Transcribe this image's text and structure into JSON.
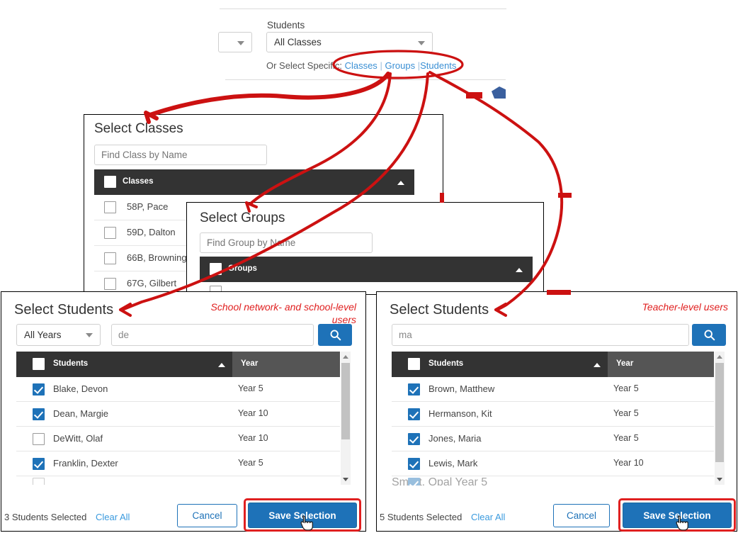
{
  "top": {
    "students_label": "Students",
    "class_select_value": "All Classes",
    "or_select_prefix": "Or Select Specific:",
    "links": [
      "Classes",
      "Groups",
      "Students"
    ],
    "separator": "|"
  },
  "select_classes": {
    "title": "Select Classes",
    "search_placeholder": "Find Class by Name",
    "header_label": "Classes",
    "rows": [
      {
        "name": "58P, Pace",
        "checked": false
      },
      {
        "name": "59D, Dalton",
        "checked": false
      },
      {
        "name": "66B, Browning",
        "checked": false
      },
      {
        "name": "67G, Gilbert",
        "checked": false
      }
    ]
  },
  "select_groups": {
    "title": "Select Groups",
    "search_placeholder": "Find Group by Name",
    "header_label": "Groups",
    "rows": [
      {
        "name": "",
        "checked": false
      }
    ]
  },
  "select_students_left": {
    "title": "Select Students",
    "note": "School network- and school-level users",
    "year_filter_value": "All Years",
    "search_value": "de",
    "search_icon": "search-icon",
    "columns": [
      "Students",
      "Year"
    ],
    "rows": [
      {
        "name": "Blake, Devon",
        "year": "Year 5",
        "checked": true
      },
      {
        "name": "Dean, Margie",
        "year": "Year 10",
        "checked": true
      },
      {
        "name": "DeWitt, Olaf",
        "year": "Year 10",
        "checked": false
      },
      {
        "name": "Franklin, Dexter",
        "year": "Year 5",
        "checked": true
      }
    ],
    "footer": {
      "status": "3 Students Selected",
      "clear_all": "Clear All",
      "cancel": "Cancel",
      "save": "Save Selection"
    }
  },
  "select_students_right": {
    "title": "Select Students",
    "note": "Teacher-level users",
    "search_value": "ma",
    "search_icon": "search-icon",
    "columns": [
      "Students",
      "Year"
    ],
    "rows": [
      {
        "name": "Brown, Matthew",
        "year": "Year 5",
        "checked": true
      },
      {
        "name": "Hermanson, Kit",
        "year": "Year 5",
        "checked": true
      },
      {
        "name": "Jones, Maria",
        "year": "Year 5",
        "checked": true
      },
      {
        "name": "Lewis, Mark",
        "year": "Year 10",
        "checked": true
      },
      {
        "name": "Smart, Opal",
        "year": "Year 5",
        "checked": true
      }
    ],
    "footer": {
      "status": "5 Students Selected",
      "clear_all": "Clear All",
      "cancel": "Cancel",
      "save": "Save Selection"
    }
  },
  "colors": {
    "annotation_red": "#cc1111",
    "primary_blue": "#1e72b8",
    "link_blue": "#3a8fd4",
    "header_dark": "#333333",
    "header_year": "#555555"
  }
}
